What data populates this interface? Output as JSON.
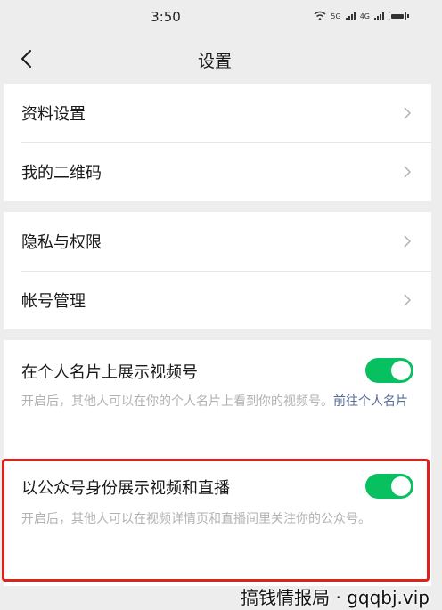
{
  "status": {
    "time": "3:50",
    "net1": "5G",
    "net2": "4G"
  },
  "nav": {
    "title": "设置"
  },
  "group1": [
    {
      "label": "资料设置"
    },
    {
      "label": "我的二维码"
    }
  ],
  "group2": [
    {
      "label": "隐私与权限"
    },
    {
      "label": "帐号管理"
    }
  ],
  "card_toggle": {
    "title": "在个人名片上展示视频号",
    "desc": "开启后，其他人可以在你的个人名片上看到你的视频号。",
    "link": "前往个人名片",
    "enabled": true
  },
  "official_toggle": {
    "title": "以公众号身份展示视频和直播",
    "desc": "开启后，其他人可以在视频详情页和直播间里关注你的公众号。",
    "enabled": true
  },
  "colors": {
    "switch_on": "#07c160",
    "link": "#576b95",
    "highlight": "#e0201b"
  },
  "watermark": "搞钱情报局 · gqqbj.vip"
}
